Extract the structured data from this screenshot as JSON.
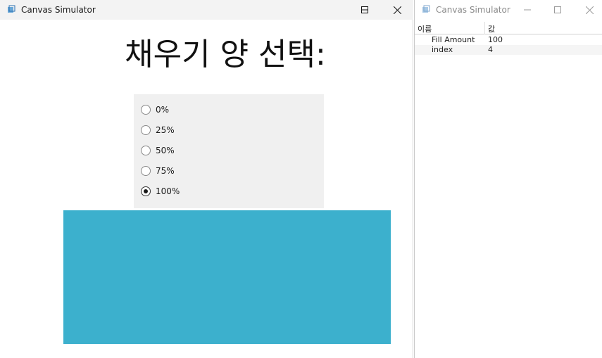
{
  "main_window": {
    "title": "Canvas Simulator",
    "heading": "채우기 양 선택:",
    "radio_options": [
      "0%",
      "25%",
      "50%",
      "75%",
      "100%"
    ],
    "selected_index": 4,
    "fill_fraction": 1.0,
    "fill_color": "#3cb0cd"
  },
  "inspector_window": {
    "title": "Canvas Simulator",
    "columns": {
      "name": "이름",
      "value": "값"
    },
    "rows": [
      {
        "name": "Fill Amount",
        "value": "100"
      },
      {
        "name": "index",
        "value": "4"
      }
    ]
  }
}
